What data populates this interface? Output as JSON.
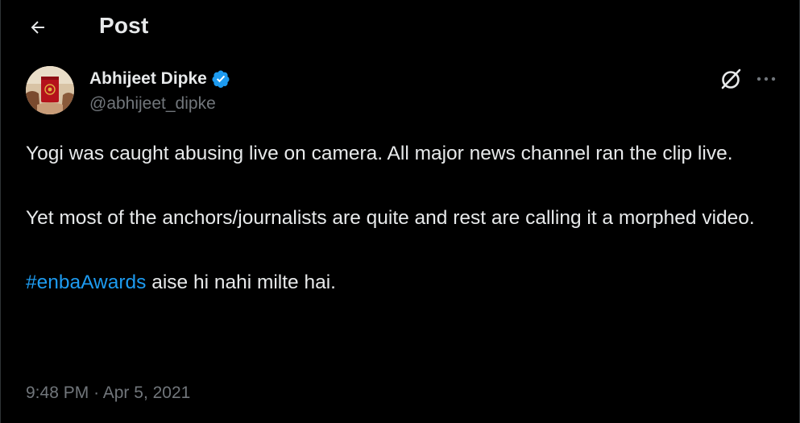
{
  "header": {
    "title": "Post",
    "back_icon": "arrow-left-icon"
  },
  "author": {
    "name": "Abhijeet Dipke",
    "handle": "@abhijeet_dipke",
    "verified": true,
    "verified_color": "#1d9bf0"
  },
  "actions": {
    "grok_icon": "grok-icon",
    "more_icon": "more-horizontal-icon"
  },
  "tweet": {
    "line1": "Yogi was caught abusing live on camera. All major news channel ran the clip live.",
    "line2": "Yet most of the anchors/journalists are quite and rest are calling it a morphed video.",
    "hashtag": "#enbaAwards",
    "line3_rest": " aise hi nahi milte hai."
  },
  "meta": {
    "time": "9:48 PM",
    "separator": "·",
    "date": "Apr 5, 2021"
  },
  "colors": {
    "background": "#000000",
    "text": "#e7e9ea",
    "muted": "#71767b",
    "accent": "#1d9bf0"
  }
}
